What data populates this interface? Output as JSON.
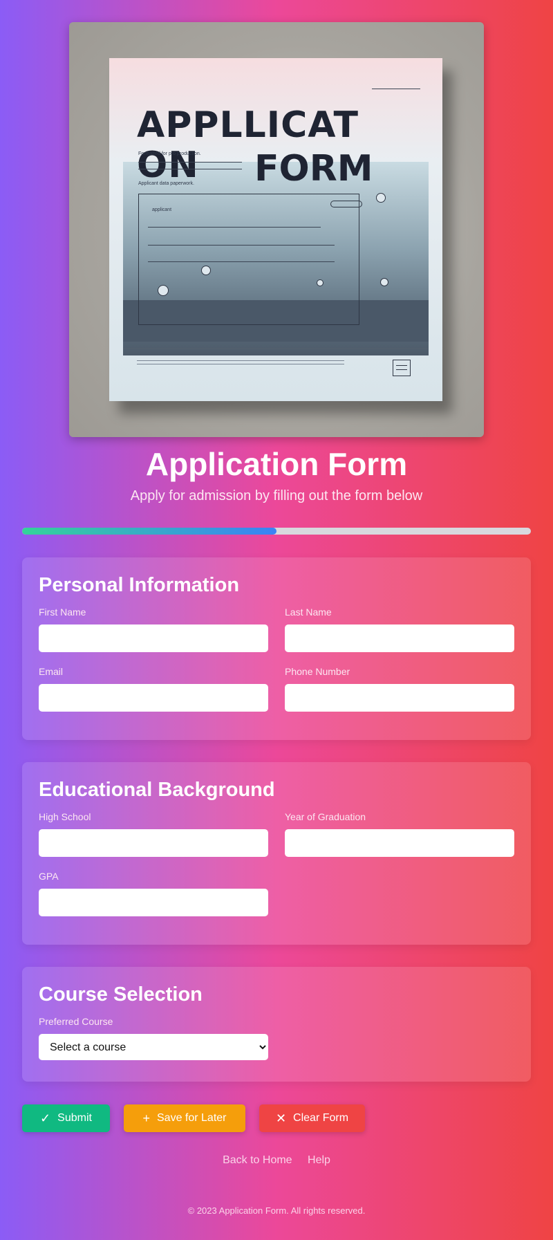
{
  "hero": {
    "image_title_line1": "APPLLICAT ON",
    "image_title_line2": "FORM",
    "image_small_1": "Formatted for pro production.",
    "image_small_2": "Applicant data paperwork.",
    "image_small_3": "applicant"
  },
  "header": {
    "title": "Application Form",
    "subtitle": "Apply for admission by filling out the form below"
  },
  "progress": {
    "value_fraction": 0.5
  },
  "personal": {
    "heading": "Personal Information",
    "first_name_label": "First Name",
    "first_name_value": "",
    "last_name_label": "Last Name",
    "last_name_value": "",
    "email_label": "Email",
    "email_value": "",
    "phone_label": "Phone Number",
    "phone_value": ""
  },
  "education": {
    "heading": "Educational Background",
    "high_school_label": "High School",
    "high_school_value": "",
    "graduation_year_label": "Year of Graduation",
    "graduation_year_value": "",
    "gpa_label": "GPA",
    "gpa_value": ""
  },
  "course": {
    "heading": "Course Selection",
    "preferred_course_label": "Preferred Course",
    "selected_option": "Select a course"
  },
  "actions": {
    "submit_label": "Submit",
    "submit_icon": "check-icon",
    "save_label": "Save for Later",
    "save_icon": "plus-icon",
    "clear_label": "Clear Form",
    "clear_icon": "x-icon"
  },
  "links": {
    "home": "Back to Home",
    "help": "Help"
  },
  "footer": {
    "copyright": "© 2023 Application Form. All rights reserved."
  },
  "colors": {
    "bg_start": "#8b5cf6",
    "bg_mid": "#ec4899",
    "bg_end": "#ef4444",
    "submit": "#10b981",
    "save": "#f59e0b",
    "clear": "#ef4444"
  }
}
